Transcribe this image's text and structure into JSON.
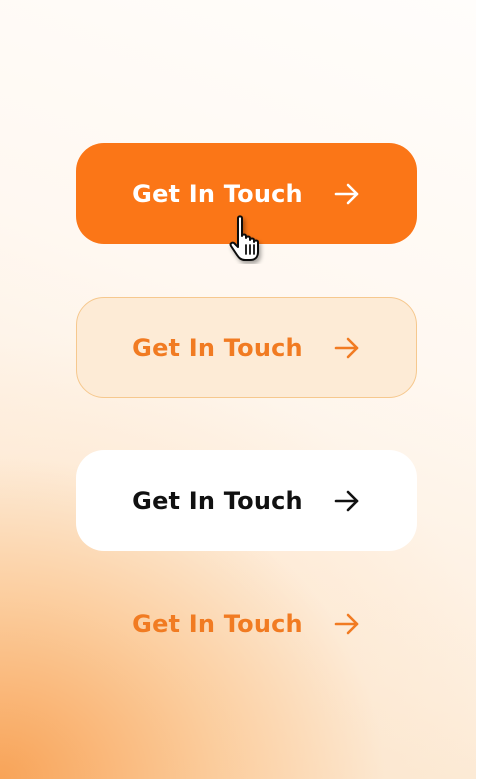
{
  "buttons": {
    "primary": {
      "label": "Get In Touch"
    },
    "outline": {
      "label": "Get In Touch"
    },
    "white": {
      "label": "Get In Touch"
    },
    "text": {
      "label": "Get In Touch"
    }
  },
  "icons": {
    "arrow": "arrow-right-icon",
    "cursor": "hand-pointer-cursor-icon"
  },
  "colors": {
    "accent": "#fb7617",
    "accent_text": "#f17b22",
    "outline_bg": "#fdebd6",
    "outline_border": "#f6c88e",
    "dark_text": "#111111",
    "white": "#ffffff"
  }
}
